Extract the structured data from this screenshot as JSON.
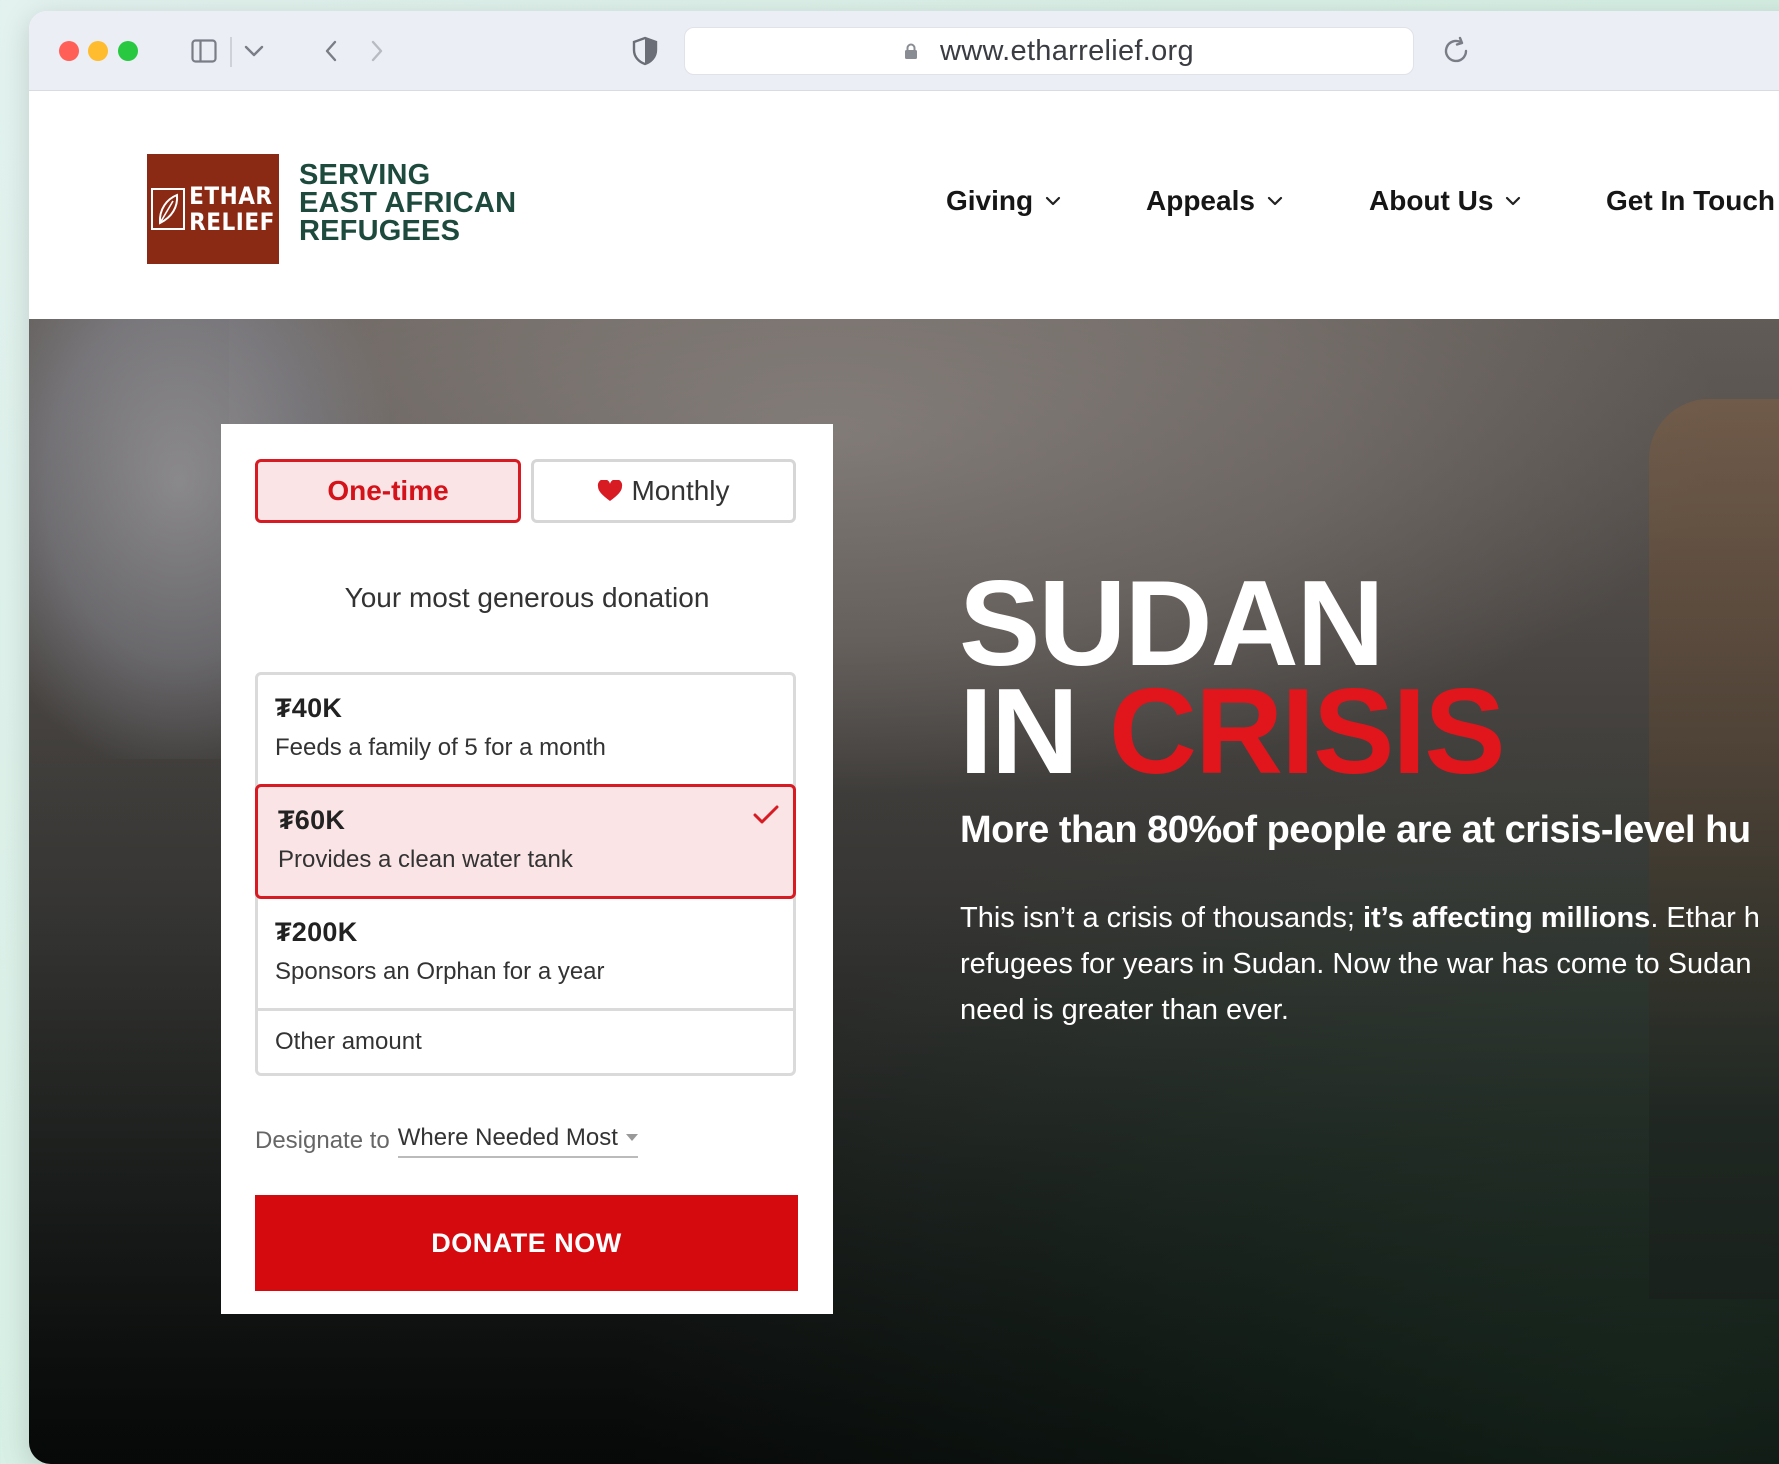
{
  "browser": {
    "url": "www.etharrelief.org"
  },
  "header": {
    "logo_line1": "ETHAR",
    "logo_line2": "RELIEF",
    "tagline_line1": "SERVING",
    "tagline_line2": "EAST AFRICAN",
    "tagline_line3": "REFUGEES",
    "nav": [
      {
        "label": "Giving",
        "has_dropdown": true
      },
      {
        "label": "Appeals",
        "has_dropdown": true
      },
      {
        "label": "About Us",
        "has_dropdown": true
      },
      {
        "label": "Get In Touch",
        "has_dropdown": false
      }
    ]
  },
  "hero": {
    "title_line1": "SUDAN",
    "title_in": "IN",
    "title_crisis": "CRISIS",
    "subtitle": "More than 80%of people are at crisis-level hu",
    "body_line1_a": "This isn’t a crisis of thousands; ",
    "body_line1_bold": "it’s affecting millions",
    "body_line1_b": ". Ethar h",
    "body_line2": "refugees for years in Sudan. Now the war has come to Sudan",
    "body_line3": "need is greater than ever."
  },
  "donation": {
    "frequency": {
      "one_time": "One-time",
      "monthly": "Monthly",
      "selected": "one_time"
    },
    "heading": "Your most generous donation",
    "options": [
      {
        "amount": "₮40K",
        "description": "Feeds a family of 5 for a month",
        "selected": false
      },
      {
        "amount": "₮60K",
        "description": "Provides a clean water tank",
        "selected": true
      },
      {
        "amount": "₮200K",
        "description": "Sponsors an Orphan for a year",
        "selected": false
      }
    ],
    "other_amount": "Other amount",
    "designate_label": "Designate to",
    "designate_value": "Where Needed Most",
    "donate_button": "DONATE NOW"
  },
  "colors": {
    "brand_red": "#d50a0f",
    "brand_green": "#1e4a3e",
    "logo_brown": "#8b2a14"
  },
  "icons": [
    "sidebar-icon",
    "chevron-down-icon",
    "back-icon",
    "forward-icon",
    "shield-icon",
    "lock-icon",
    "reload-icon",
    "leaf-icon",
    "heart-icon",
    "check-icon",
    "caret-down-icon"
  ]
}
